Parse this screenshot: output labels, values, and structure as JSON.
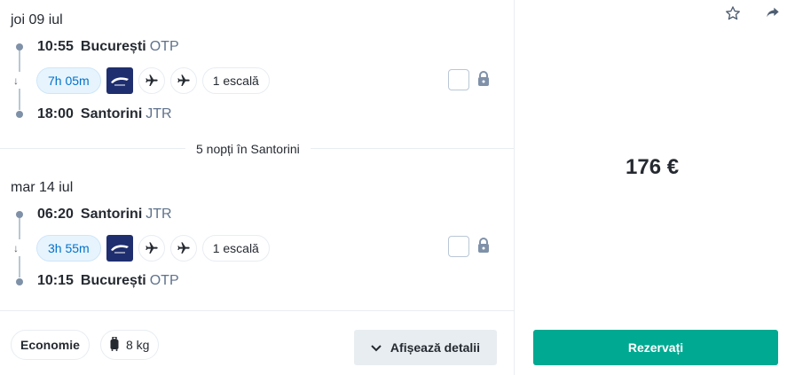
{
  "outbound": {
    "date": "joi 09 iul",
    "departure": {
      "time": "10:55",
      "city": "București",
      "code": "OTP"
    },
    "arrival": {
      "time": "18:00",
      "city": "Santorini",
      "code": "JTR"
    },
    "duration": "7h 05m",
    "stops": "1 escală",
    "airline_icon": "airline-logo",
    "segment_icons": [
      "plane-icon",
      "plane-icon"
    ]
  },
  "nights_label": "5 nopți în Santorini",
  "inbound": {
    "date": "mar 14 iul",
    "departure": {
      "time": "06:20",
      "city": "Santorini",
      "code": "JTR"
    },
    "arrival": {
      "time": "10:15",
      "city": "București",
      "code": "OTP"
    },
    "duration": "3h 55m",
    "stops": "1 escală",
    "airline_icon": "airline-logo",
    "segment_icons": [
      "plane-icon",
      "plane-icon"
    ]
  },
  "fare": {
    "class_label": "Economie",
    "baggage_label": "8 kg"
  },
  "details_button": "Afișează detalii",
  "price": "176 €",
  "book_button": "Rezervați",
  "icons": {
    "favorite": "star-icon",
    "share": "share-icon"
  },
  "colors": {
    "accent": "#00a991",
    "duration_text": "#0172cb",
    "duration_bg": "#e8f4fd"
  }
}
